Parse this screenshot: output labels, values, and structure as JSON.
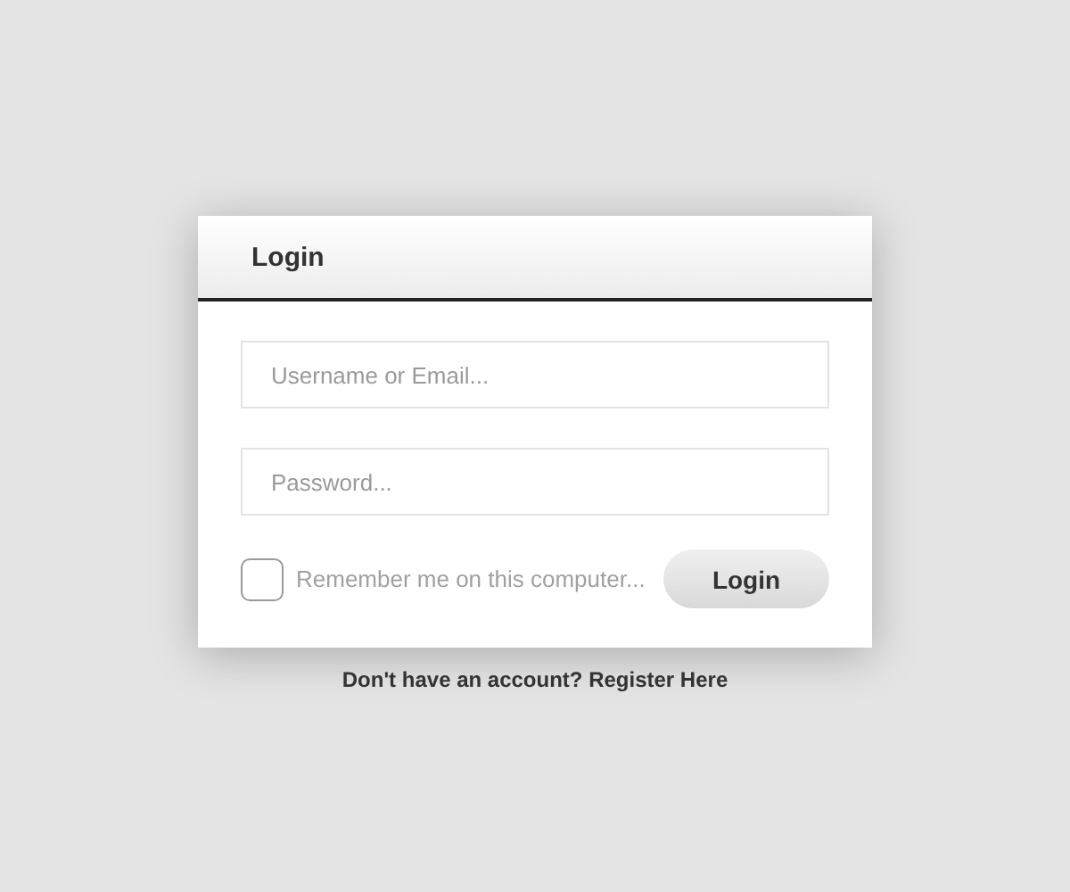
{
  "panel": {
    "title": "Login"
  },
  "fields": [
    {
      "placeholder": "Username or Email..."
    },
    {
      "placeholder": "Password..."
    }
  ],
  "remember": {
    "label": "Remember me on this computer...",
    "checked": false
  },
  "login_button": "Login",
  "footer_text": "Don't have an account? Register Here"
}
